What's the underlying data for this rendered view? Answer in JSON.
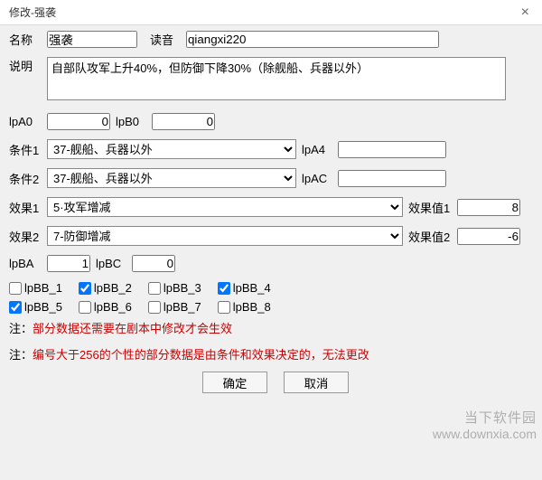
{
  "window": {
    "title": "修改-强袭",
    "close": "×"
  },
  "fields": {
    "name_label": "名称",
    "name_value": "强袭",
    "yomi_label": "读音",
    "yomi_value": "qiangxi220",
    "desc_label": "说明",
    "desc_value": "自部队攻军上升40%，但防御下降30%（除舰船、兵器以外）",
    "lpA0_label": "lpA0",
    "lpA0_value": "0",
    "lpB0_label": "lpB0",
    "lpB0_value": "0",
    "cond1_label": "条件1",
    "cond1_value": "37-舰船、兵器以外",
    "lpA4_label": "lpA4",
    "lpA4_value": "",
    "cond2_label": "条件2",
    "cond2_value": "37-舰船、兵器以外",
    "lpAC_label": "lpAC",
    "lpAC_value": "",
    "eff1_label": "效果1",
    "eff1_value": "5·攻军增减",
    "effv1_label": "效果值1",
    "effv1_value": "8",
    "eff2_label": "效果2",
    "eff2_value": "7-防御增减",
    "effv2_label": "效果值2",
    "effv2_value": "-6",
    "lpBA_label": "lpBA",
    "lpBA_value": "1",
    "lpBC_label": "lpBC",
    "lpBC_value": "0"
  },
  "checks": {
    "lpBB_1": "lpBB_1",
    "lpBB_2": "lpBB_2",
    "lpBB_3": "lpBB_3",
    "lpBB_4": "lpBB_4",
    "lpBB_5": "lpBB_5",
    "lpBB_6": "lpBB_6",
    "lpBB_7": "lpBB_7",
    "lpBB_8": "lpBB_8"
  },
  "checkStates": {
    "lpBB_1": false,
    "lpBB_2": true,
    "lpBB_3": false,
    "lpBB_4": true,
    "lpBB_5": true,
    "lpBB_6": false,
    "lpBB_7": false,
    "lpBB_8": false
  },
  "notes": {
    "prefix": "注：",
    "n1": "部分数据还需要在剧本中修改才会生效",
    "n2": "编号大于256的个性的部分数据是由条件和效果决定的，无法更改"
  },
  "buttons": {
    "ok": "确定",
    "cancel": "取消"
  },
  "watermark": {
    "line1": "当下软件园",
    "line2": "www.downxia.com"
  }
}
